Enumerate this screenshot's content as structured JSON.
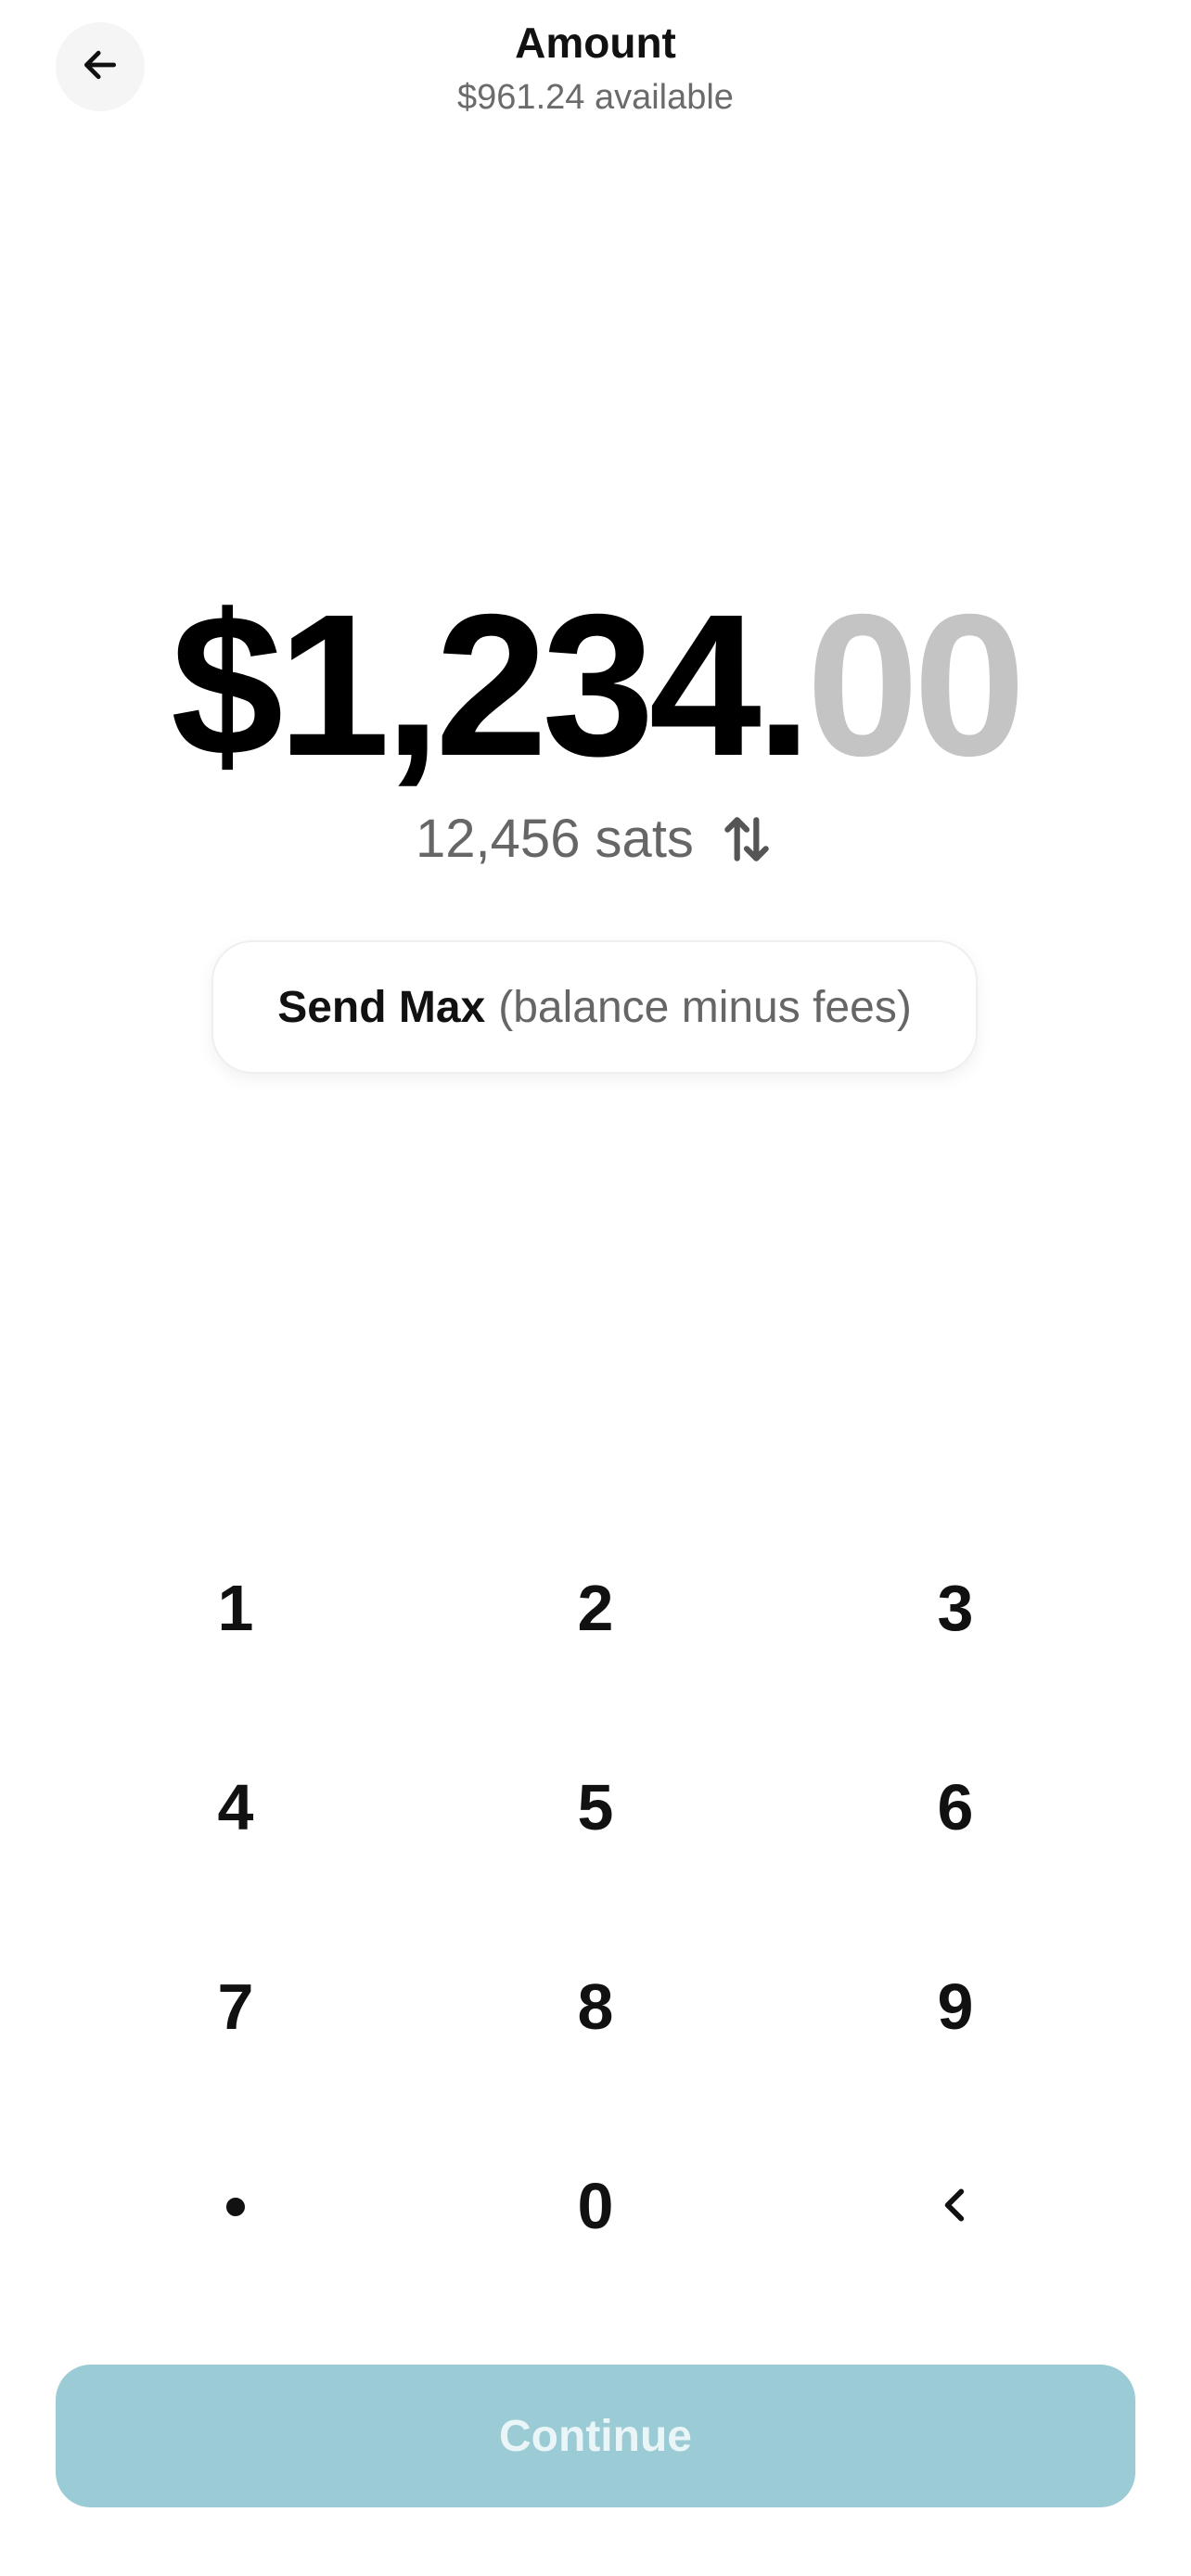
{
  "header": {
    "title": "Amount",
    "subtitle": "$961.24 available",
    "back_icon": "arrow-left-icon"
  },
  "amount": {
    "main": "$1,234.",
    "cents": "00",
    "sats": "12,456 sats",
    "swap_icon": "swap-vertical-icon"
  },
  "send_max": {
    "label": "Send Max",
    "hint": "(balance minus fees)"
  },
  "keypad": {
    "keys": [
      "1",
      "2",
      "3",
      "4",
      "5",
      "6",
      "7",
      "8",
      "9",
      "•",
      "0"
    ],
    "backspace_icon": "chevron-left-icon"
  },
  "continue": {
    "label": "Continue",
    "state": "disabled"
  },
  "colors": {
    "accent_disabled": "#9bcbd4",
    "cents_muted": "#c4c4c4",
    "secondary_text": "#666666"
  }
}
